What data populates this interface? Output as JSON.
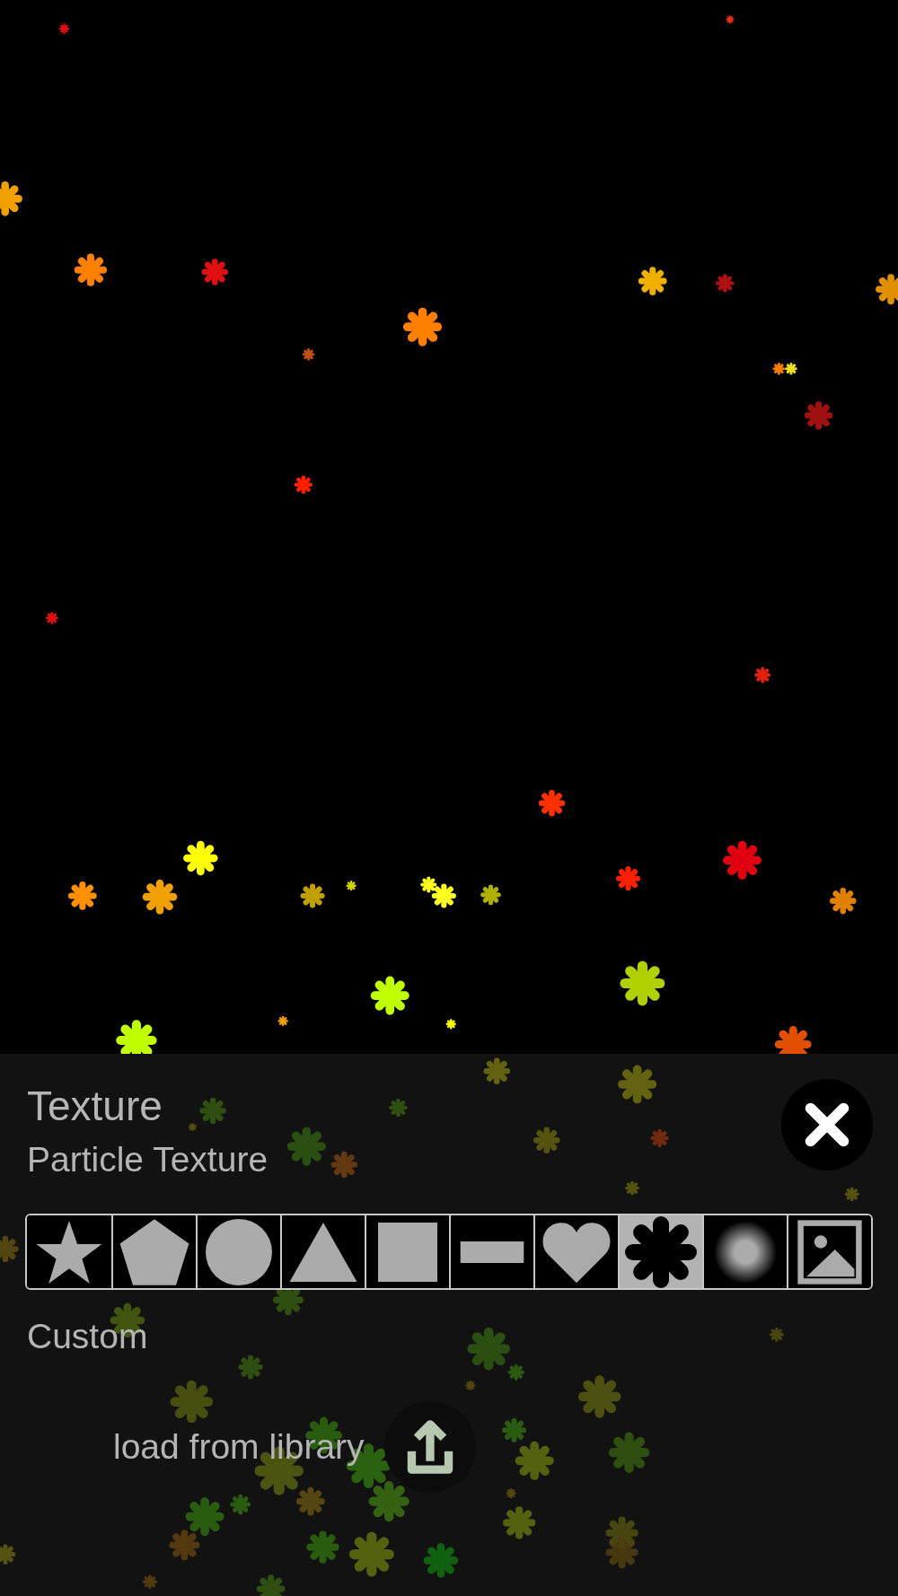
{
  "panel": {
    "title": "Texture",
    "subtitle": "Particle Texture",
    "textures": [
      {
        "kind": "star",
        "selected": false
      },
      {
        "kind": "pentagon",
        "selected": false
      },
      {
        "kind": "circle",
        "selected": false
      },
      {
        "kind": "triangle",
        "selected": false
      },
      {
        "kind": "square",
        "selected": false
      },
      {
        "kind": "bar",
        "selected": false
      },
      {
        "kind": "heart",
        "selected": false
      },
      {
        "kind": "asterisk",
        "selected": true
      },
      {
        "kind": "glow",
        "selected": false
      },
      {
        "kind": "image",
        "selected": false
      }
    ],
    "custom_label": "Custom",
    "load_label": "load from library"
  }
}
